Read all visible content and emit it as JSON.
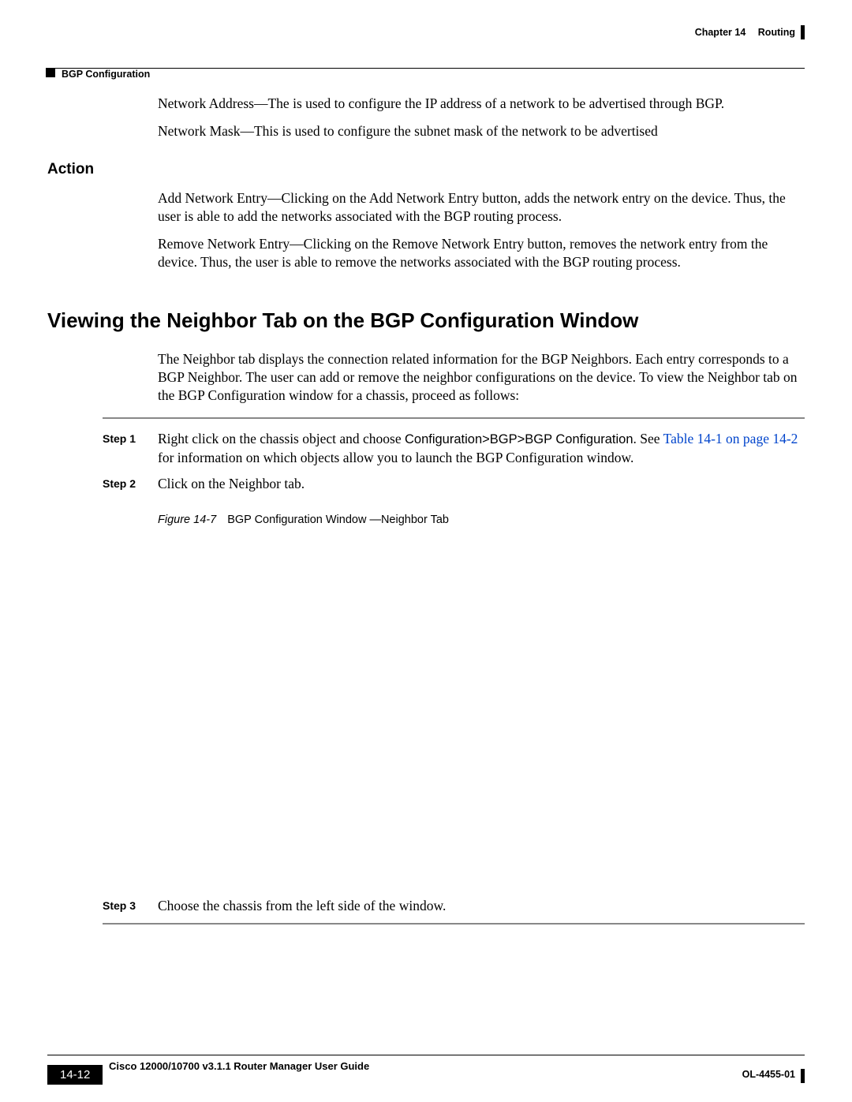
{
  "header": {
    "chapter_label": "Chapter 14",
    "chapter_title": "Routing",
    "section_breadcrumb": "BGP Configuration"
  },
  "intro_paras": [
    "Network Address—The is used to configure the IP address of a network to be advertised through BGP.",
    "Network Mask—This is used to configure the subnet mask of the network to be advertised"
  ],
  "action": {
    "heading": "Action",
    "paras": [
      "Add Network Entry—Clicking on the Add Network Entry button, adds the network entry on the device. Thus, the user is able to add the networks associated with the BGP routing process.",
      "Remove Network Entry—Clicking on the Remove Network Entry button, removes the network entry from the device. Thus, the user is able to remove the networks associated with the BGP routing process."
    ]
  },
  "main": {
    "heading": "Viewing the Neighbor Tab on the BGP Configuration Window",
    "intro": "The Neighbor tab displays the connection related information for the BGP Neighbors. Each entry corresponds to a BGP Neighbor. The user can add or remove the neighbor configurations on the device. To view the Neighbor tab on the BGP Configuration window for a chassis, proceed as follows:",
    "steps": {
      "s1_label": "Step 1",
      "s1_pre": "Right click on the chassis object and choose ",
      "s1_nav": "Configuration>BGP>BGP Configuration",
      "s1_post1": ". See ",
      "s1_link": "Table 14-1 on page 14-2",
      "s1_post2": " for information on which objects allow you to launch the BGP Configuration window.",
      "s2_label": "Step 2",
      "s2_text": "Click on the Neighbor tab.",
      "s3_label": "Step 3",
      "s3_text": "Choose the chassis from the left side of the window."
    },
    "figure": {
      "id": "Figure 14-7",
      "title": "BGP Configuration Window    —Neighbor Tab"
    }
  },
  "footer": {
    "book_title": "Cisco 12000/10700 v3.1.1 Router Manager User Guide",
    "page_number": "14-12",
    "doc_id": "OL-4455-01"
  }
}
